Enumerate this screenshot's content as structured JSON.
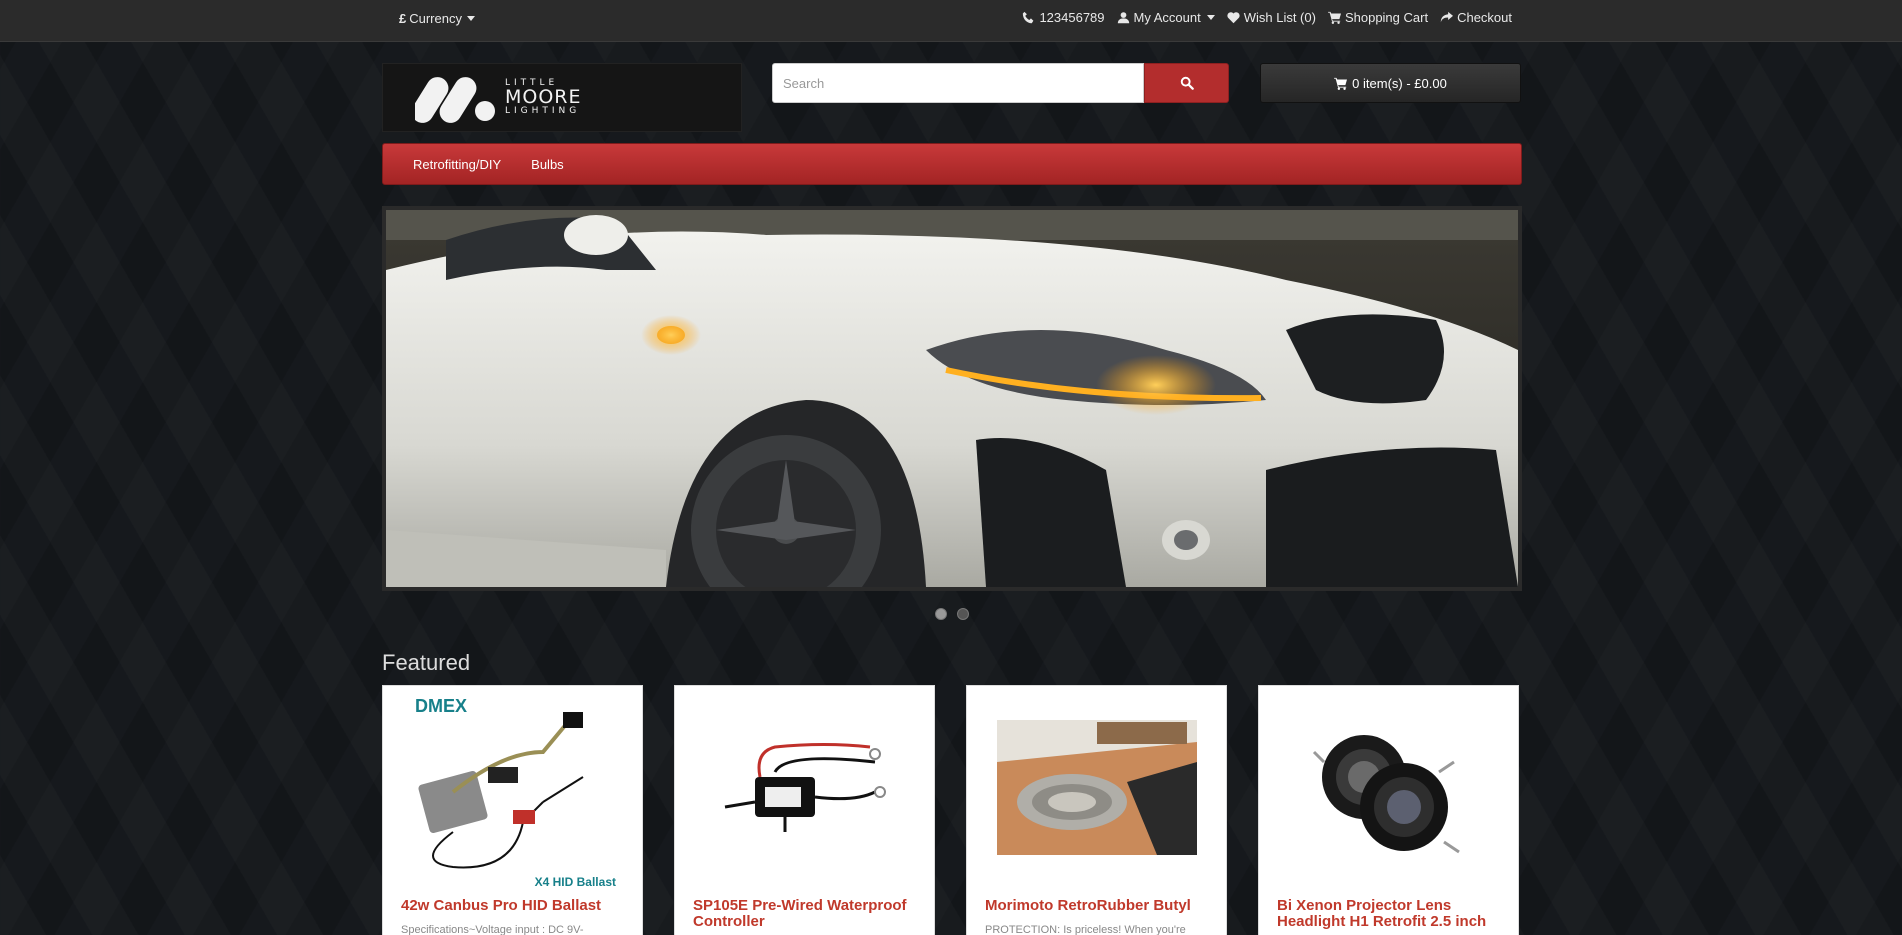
{
  "topbar": {
    "currency_symbol": "£",
    "currency_label": "Currency",
    "phone": "123456789",
    "my_account": "My Account",
    "wishlist": "Wish List (0)",
    "shopping_cart": "Shopping Cart",
    "checkout": "Checkout"
  },
  "logo": {
    "line1": "LITTLE",
    "line2": "MOORE",
    "line3": "LIGHTING"
  },
  "search": {
    "placeholder": "Search"
  },
  "cart": {
    "label": "0 item(s) - £0.00"
  },
  "menu": {
    "items": [
      "Retrofitting/DIY",
      "Bulbs"
    ]
  },
  "slider": {
    "slide_count": 2,
    "active_slide": 1
  },
  "featured": {
    "title": "Featured",
    "products": [
      {
        "image_label_top": "DMEX",
        "image_label_bottom": "X4 HID Ballast",
        "name": "42w Canbus Pro HID Ballast",
        "desc": "Specifications~Voltage input : DC 9V-"
      },
      {
        "name": "SP105E Pre-Wired Waterproof Controller",
        "desc": ""
      },
      {
        "name": "Morimoto RetroRubber Butyl",
        "desc": "PROTECTION: Is priceless! When you're"
      },
      {
        "name": "Bi Xenon Projector Lens Headlight H1 Retrofit 2.5 inch",
        "desc": ""
      }
    ]
  },
  "colors": {
    "accent": "#b32d2d",
    "product_name": "#c0392b",
    "topbar": "#2b2b2b"
  }
}
